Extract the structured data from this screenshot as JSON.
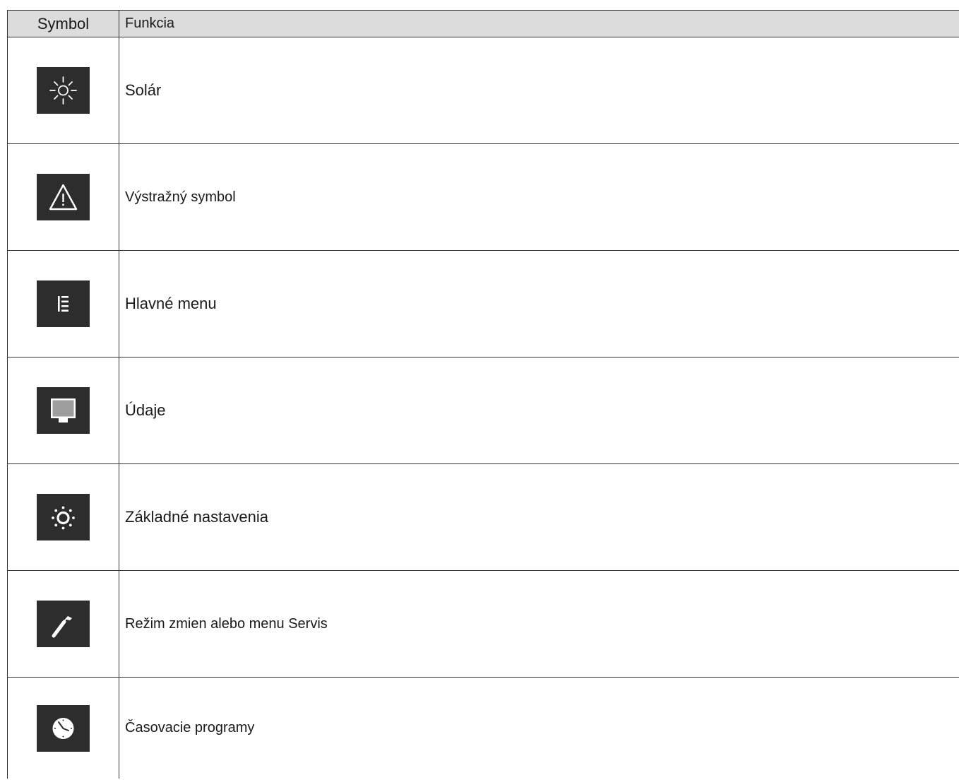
{
  "table": {
    "header": {
      "symbol": "Symbol",
      "function": "Funkcia"
    },
    "rows": [
      {
        "icon": "sun-icon",
        "label": "Solár"
      },
      {
        "icon": "warning-triangle-icon",
        "label": "Výstražný symbol"
      },
      {
        "icon": "main-menu-icon",
        "label": "Hlavné menu"
      },
      {
        "icon": "monitor-icon",
        "label": "Údaje"
      },
      {
        "icon": "basic-settings-icon",
        "label": "Základné nastavenia"
      },
      {
        "icon": "wrench-icon",
        "label": "Režim zmien alebo menu Servis"
      },
      {
        "icon": "clock-icon",
        "label": "Časovacie programy"
      }
    ]
  },
  "colors": {
    "icon_background": "#2d2d2d",
    "header_background": "#dcdcdc",
    "border": "#333333"
  }
}
